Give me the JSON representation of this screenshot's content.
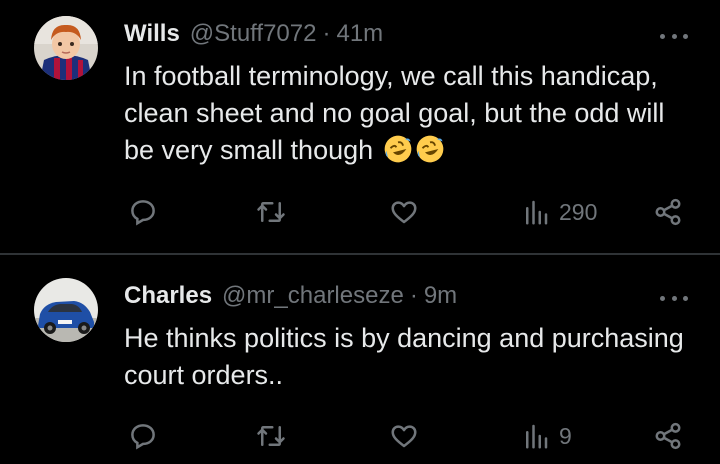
{
  "tweets": [
    {
      "name": "Wills",
      "handle": "@Stuff7072",
      "separator": "·",
      "time": "41m",
      "text": "In football terminology, we call this handicap, clean sheet and no goal goal, but the odd will be very small though",
      "emojis": [
        "rolling-on-floor-laughing",
        "rolling-on-floor-laughing"
      ],
      "views": "290"
    },
    {
      "name": "Charles",
      "handle": "@mr_charleseze",
      "separator": "·",
      "time": "9m",
      "text": "He thinks politics is by dancing and purchasing court orders..",
      "emojis": [],
      "views": "9"
    }
  ],
  "colors": {
    "background": "#000000",
    "primary_text": "#e7e9ea",
    "secondary_text": "#71767b",
    "divider": "#2f3336"
  }
}
